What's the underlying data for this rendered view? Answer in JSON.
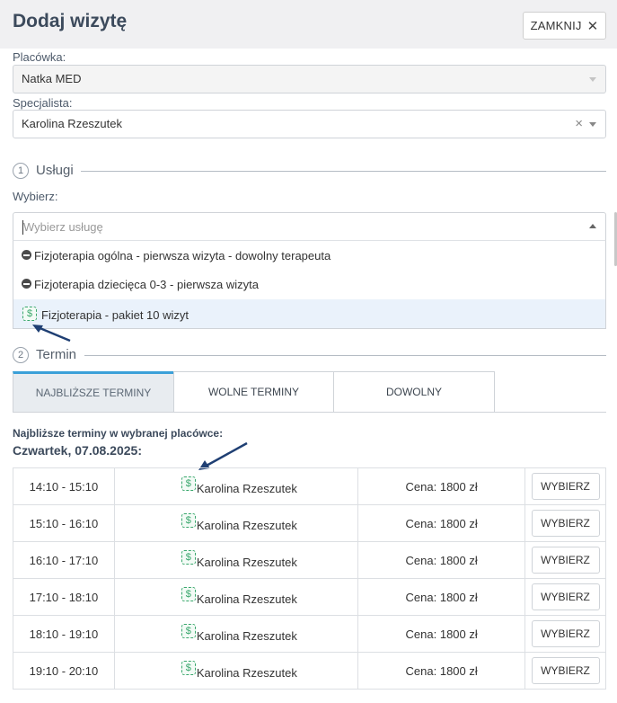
{
  "header": {
    "title": "Dodaj wizytę",
    "close_label": "ZAMKNIJ"
  },
  "clinic": {
    "label": "Placówka:",
    "value": "Natka MED"
  },
  "specialist": {
    "label": "Specjalista:",
    "value": "Karolina Rzeszutek"
  },
  "services": {
    "step": "1",
    "title": "Usługi",
    "choose_label": "Wybierz:",
    "placeholder": "Wybierz usługę",
    "options": [
      {
        "label": "Fizjoterapia ogólna - pierwsza wizyta - dowolny terapeuta",
        "icon": "minus-circle-icon"
      },
      {
        "label": "Fizjoterapia dziecięca 0-3 - pierwsza wizyta",
        "icon": "minus-circle-icon"
      },
      {
        "label": "Fizjoterapia - pakiet 10 wizyt",
        "icon": "dollar-icon"
      }
    ]
  },
  "term": {
    "step": "2",
    "title": "Termin",
    "tabs": [
      {
        "label": "NAJBLIŻSZE TERMINY",
        "active": true
      },
      {
        "label": "WOLNE TERMINY",
        "active": false
      },
      {
        "label": "DOWOLNY",
        "active": false
      }
    ],
    "nearest_heading": "Najbliższe terminy w wybranej placówce:",
    "date_heading": "Czwartek, 07.08.2025:",
    "button_label": "WYBIERZ",
    "slots": [
      {
        "time": "14:10 - 15:10",
        "specialist": "Karolina Rzeszutek",
        "price": "Cena: 1800 zł"
      },
      {
        "time": "15:10 - 16:10",
        "specialist": "Karolina Rzeszutek",
        "price": "Cena: 1800 zł"
      },
      {
        "time": "16:10 - 17:10",
        "specialist": "Karolina Rzeszutek",
        "price": "Cena: 1800 zł"
      },
      {
        "time": "17:10 - 18:10",
        "specialist": "Karolina Rzeszutek",
        "price": "Cena: 1800 zł"
      },
      {
        "time": "18:10 - 19:10",
        "specialist": "Karolina Rzeszutek",
        "price": "Cena: 1800 zł"
      },
      {
        "time": "19:10 - 20:10",
        "specialist": "Karolina Rzeszutek",
        "price": "Cena: 1800 zł"
      }
    ]
  },
  "icons": {
    "dollar_symbol": "$",
    "close_symbol": "✕",
    "clear_symbol": "×"
  },
  "colors": {
    "accent": "#3ba0d8",
    "dollar_green": "#3aa76d",
    "arrow": "#1f3f73"
  }
}
